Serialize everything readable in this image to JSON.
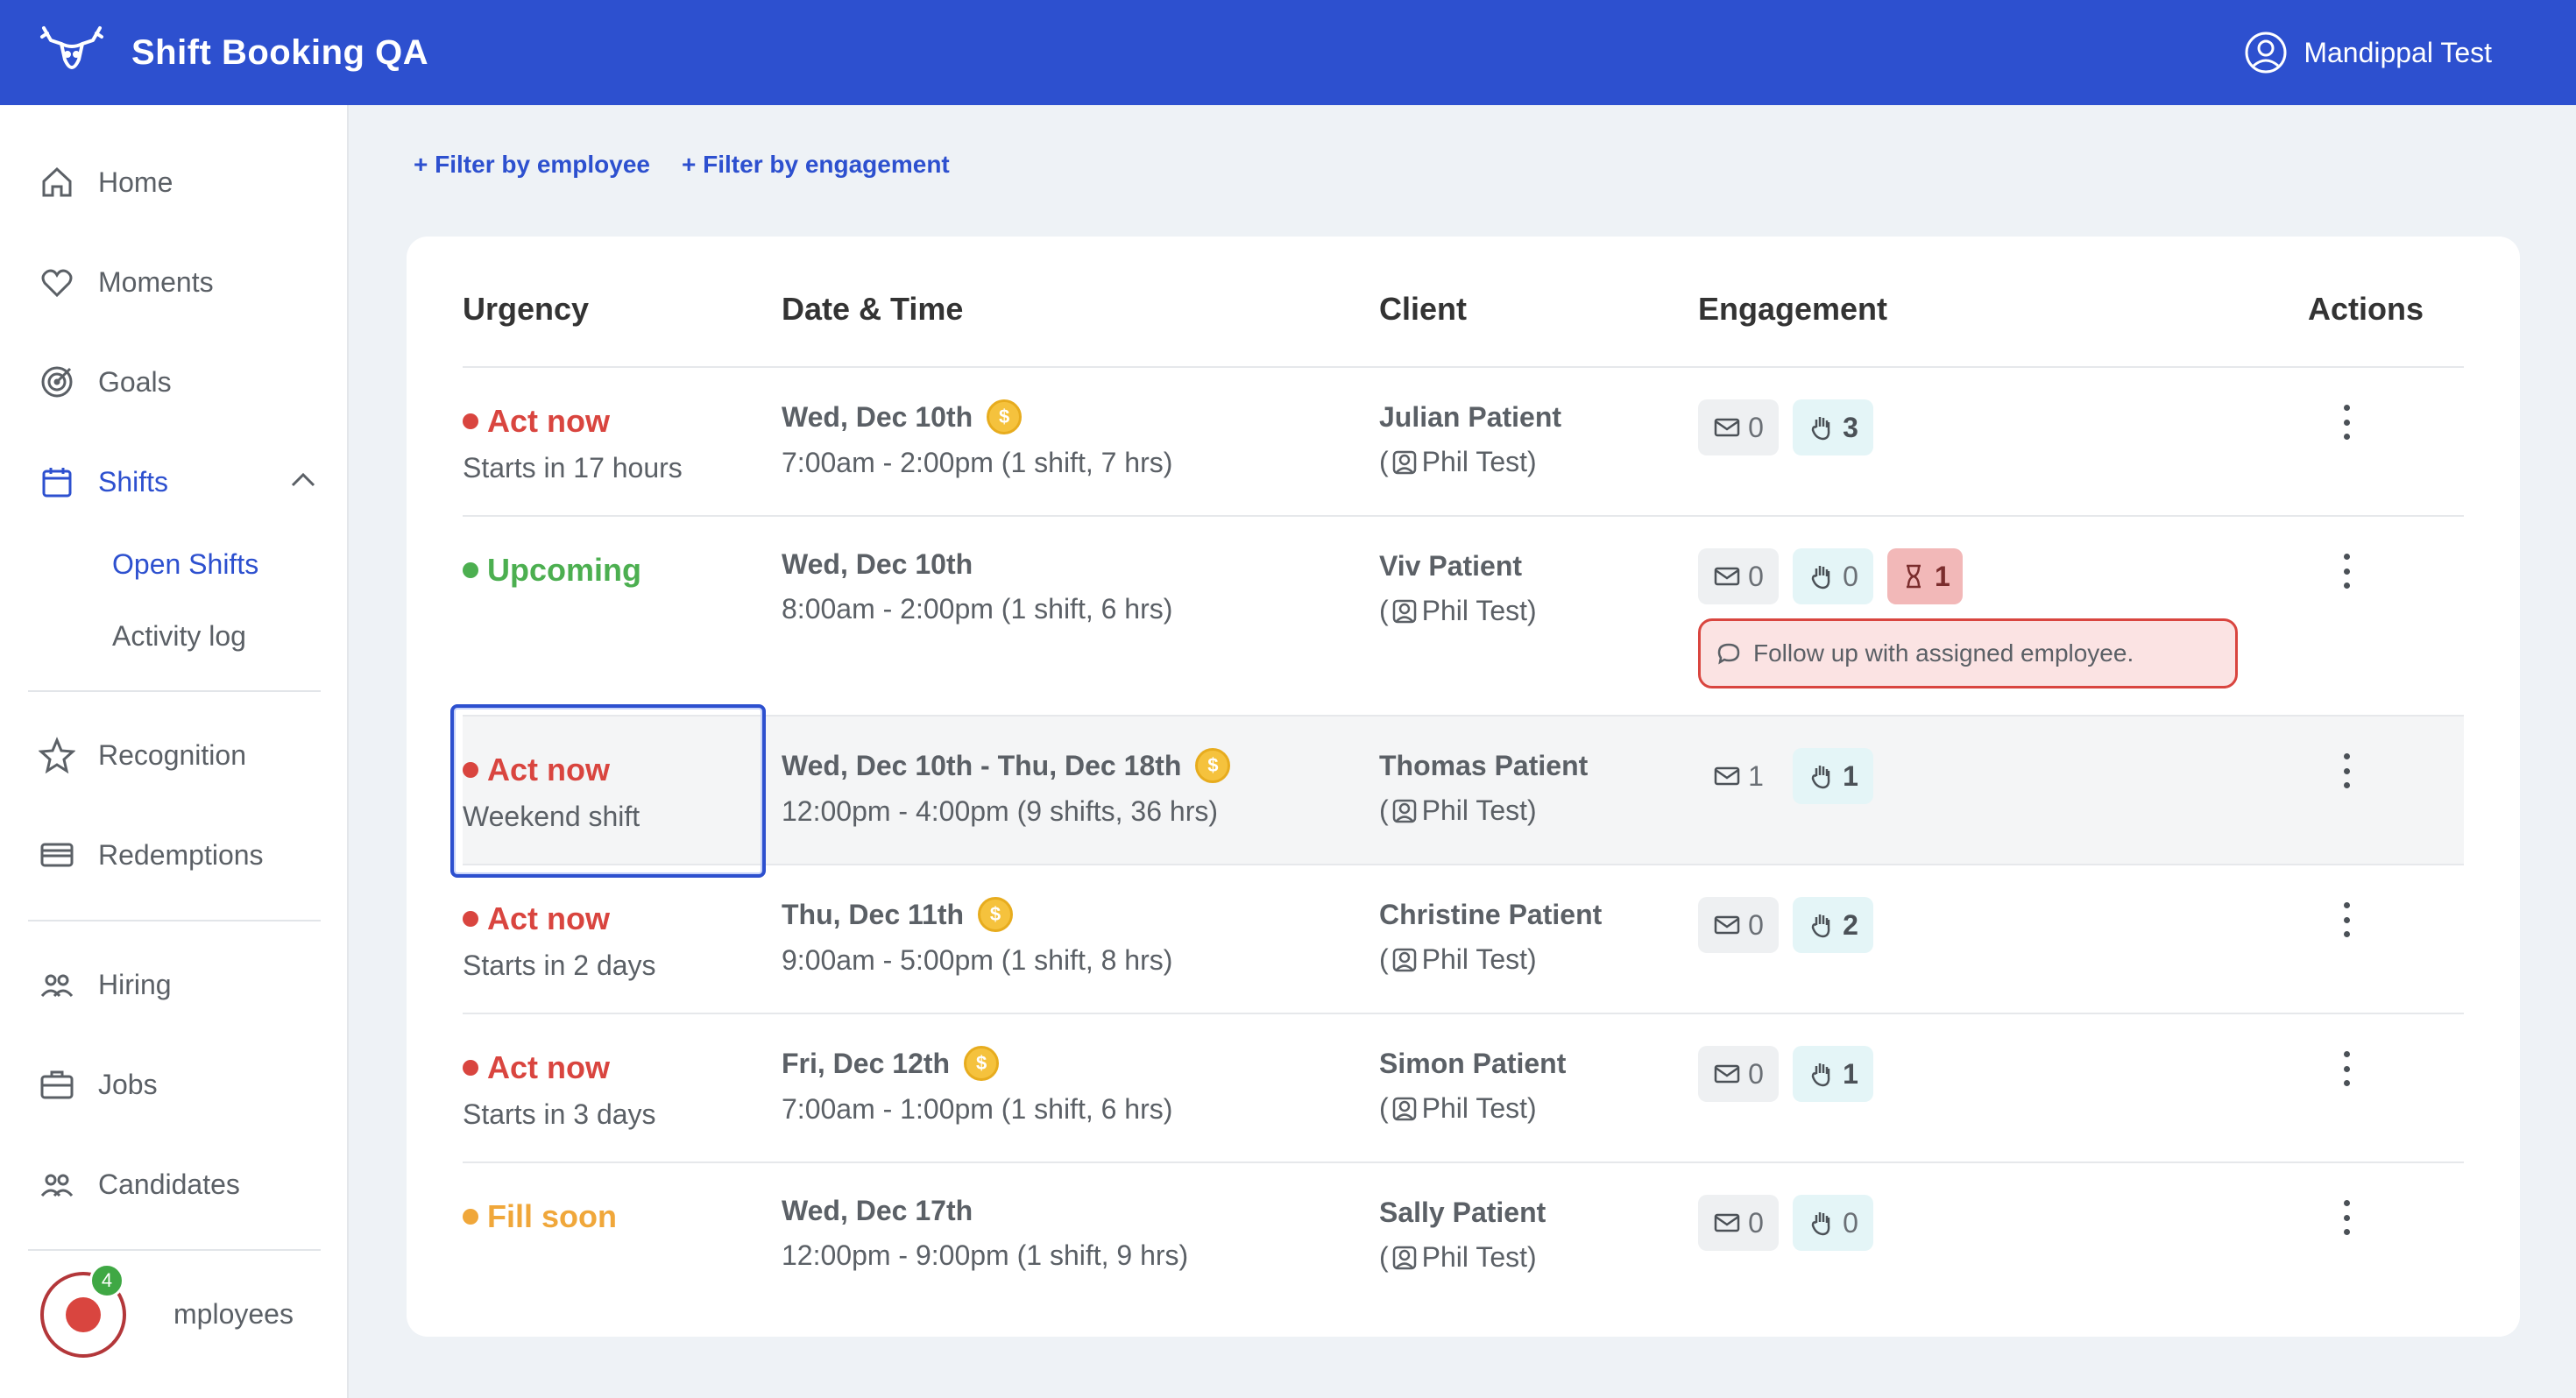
{
  "app": {
    "title": "Shift Booking QA",
    "user_name": "Mandippal Test"
  },
  "sidebar": {
    "items": [
      {
        "label": "Home",
        "icon": "home-icon"
      },
      {
        "label": "Moments",
        "icon": "heart-icon"
      },
      {
        "label": "Goals",
        "icon": "target-icon"
      },
      {
        "label": "Shifts",
        "icon": "calendar-icon",
        "active": true
      },
      {
        "label": "Recognition",
        "icon": "star-icon"
      },
      {
        "label": "Redemptions",
        "icon": "card-icon"
      },
      {
        "label": "Hiring",
        "icon": "people-icon"
      },
      {
        "label": "Jobs",
        "icon": "briefcase-icon"
      },
      {
        "label": "Candidates",
        "icon": "people-icon"
      },
      {
        "label": "mployees",
        "icon": "people-icon"
      }
    ],
    "shifts_sub": [
      {
        "label": "Open Shifts",
        "active": true
      },
      {
        "label": "Activity log"
      }
    ],
    "record_badge": "4"
  },
  "filters": {
    "by_employee": "+ Filter by employee",
    "by_engagement": "+ Filter by engagement"
  },
  "table": {
    "headers": {
      "urgency": "Urgency",
      "datetime": "Date & Time",
      "client": "Client",
      "engagement": "Engagement",
      "actions": "Actions"
    },
    "rows": [
      {
        "urgency": "Act now",
        "urgency_color": "#d9453f",
        "urgency_sub": "Starts in 17 hours",
        "date": "Wed, Dec 10th",
        "coin": true,
        "time": "7:00am - 2:00pm (1 shift, 7 hrs)",
        "client": "Julian Patient",
        "employee": "Phil Test",
        "mail": "0",
        "hand": "3",
        "hand_strong": true
      },
      {
        "urgency": "Upcoming",
        "urgency_color": "#4caf50",
        "urgency_sub": "",
        "date": "Wed, Dec 10th",
        "coin": false,
        "time": "8:00am - 2:00pm (1 shift, 6 hrs)",
        "client": "Viv Patient",
        "employee": "Phil Test",
        "mail": "0",
        "hand": "0",
        "hand_strong": false,
        "hourglass": "1",
        "note": "Follow up with assigned employee."
      },
      {
        "urgency": "Act now",
        "urgency_color": "#d9453f",
        "urgency_sub": "Weekend shift",
        "date": "Wed, Dec 10th - Thu, Dec 18th",
        "coin": true,
        "time": "12:00pm - 4:00pm (9 shifts, 36 hrs)",
        "client": "Thomas Patient",
        "employee": "Phil Test",
        "mail": "1",
        "hand": "1",
        "hand_strong": true
      },
      {
        "urgency": "Act now",
        "urgency_color": "#d9453f",
        "urgency_sub": "Starts in 2 days",
        "date": "Thu, Dec 11th",
        "coin": true,
        "time": "9:00am - 5:00pm (1 shift, 8 hrs)",
        "client": "Christine Patient",
        "employee": "Phil Test",
        "mail": "0",
        "hand": "2",
        "hand_strong": true
      },
      {
        "urgency": "Act now",
        "urgency_color": "#d9453f",
        "urgency_sub": "Starts in 3 days",
        "date": "Fri, Dec 12th",
        "coin": true,
        "time": "7:00am - 1:00pm (1 shift, 6 hrs)",
        "client": "Simon Patient",
        "employee": "Phil Test",
        "mail": "0",
        "hand": "1",
        "hand_strong": true
      },
      {
        "urgency": "Fill soon",
        "urgency_color": "#f0a73a",
        "urgency_sub": "",
        "date": "Wed, Dec 17th",
        "coin": false,
        "time": "12:00pm - 9:00pm (1 shift, 9 hrs)",
        "client": "Sally Patient",
        "employee": "Phil Test",
        "mail": "0",
        "hand": "0",
        "hand_strong": false
      }
    ]
  }
}
